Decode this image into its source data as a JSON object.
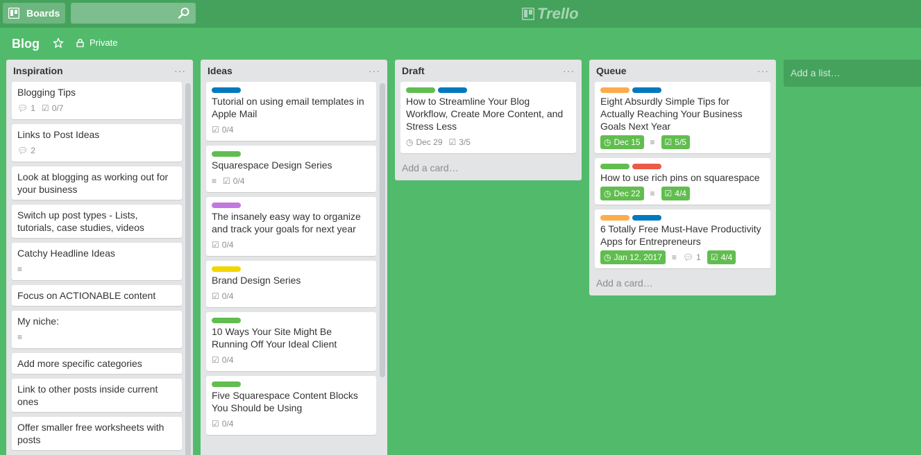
{
  "header": {
    "boards_label": "Boards",
    "search_placeholder": "",
    "logo_text": "Trello"
  },
  "board": {
    "title": "Blog",
    "privacy": "Private"
  },
  "colors": {
    "background": "#51bb6b",
    "topbar": "#44a25c",
    "label_green": "#61bd4f",
    "label_blue": "#0079bf",
    "label_orange": "#ffab4a",
    "label_purple": "#c377e0",
    "label_yellow": "#f2d600",
    "label_red": "#eb5a46"
  },
  "lists": [
    {
      "title": "Inspiration",
      "cards": [
        {
          "title": "Blogging Tips",
          "comments": "1",
          "checklist": "0/7"
        },
        {
          "title": "Links to Post Ideas",
          "comments": "2"
        },
        {
          "title": "Look at blogging as working out for your business"
        },
        {
          "title": "Switch up post types - Lists, tutorials, case studies, videos"
        },
        {
          "title": "Catchy Headline Ideas",
          "description": true
        },
        {
          "title": "Focus on ACTIONABLE content"
        },
        {
          "title": "My niche:",
          "description": true
        },
        {
          "title": "Add more specific categories"
        },
        {
          "title": "Link to other posts inside current ones"
        },
        {
          "title": "Offer smaller free worksheets with posts"
        }
      ]
    },
    {
      "title": "Ideas",
      "cards": [
        {
          "labels": [
            "blue"
          ],
          "title": "Tutorial on using email templates in Apple Mail",
          "checklist": "0/4"
        },
        {
          "labels": [
            "green"
          ],
          "title": "Squarespace Design Series",
          "description": true,
          "checklist": "0/4"
        },
        {
          "labels": [
            "purple"
          ],
          "title": "The insanely easy way to organize and track your goals for next year",
          "checklist": "0/4"
        },
        {
          "labels": [
            "yellow"
          ],
          "title": "Brand Design Series",
          "checklist": "0/4"
        },
        {
          "labels": [
            "green"
          ],
          "title": "10 Ways Your Site Might Be Running Off Your Ideal Client",
          "checklist": "0/4"
        },
        {
          "labels": [
            "green"
          ],
          "title": "Five Squarespace Content Blocks You Should be Using",
          "checklist": "0/4"
        }
      ]
    },
    {
      "title": "Draft",
      "cards": [
        {
          "labels": [
            "green",
            "blue"
          ],
          "title": "How to Streamline Your Blog Workflow, Create More Content, and Stress Less",
          "due": "Dec 29",
          "checklist": "3/5"
        }
      ],
      "add_card": "Add a card…"
    },
    {
      "title": "Queue",
      "cards": [
        {
          "labels": [
            "orange",
            "blue"
          ],
          "title": "Eight Absurdly Simple Tips for Actually Reaching Your Business Goals Next Year",
          "due": "Dec 15",
          "description": true,
          "checklist": "5/5"
        },
        {
          "labels": [
            "green",
            "red"
          ],
          "title": "How to use rich pins on squarespace",
          "due": "Dec 22",
          "description": true,
          "checklist": "4/4"
        },
        {
          "labels": [
            "orange",
            "blue"
          ],
          "title": "6 Totally Free Must-Have Productivity Apps for Entrepreneurs",
          "due": "Jan 12, 2017",
          "description": true,
          "comments": "1",
          "checklist": "4/4"
        }
      ],
      "add_card": "Add a card…"
    }
  ],
  "add_list": "Add a list…"
}
